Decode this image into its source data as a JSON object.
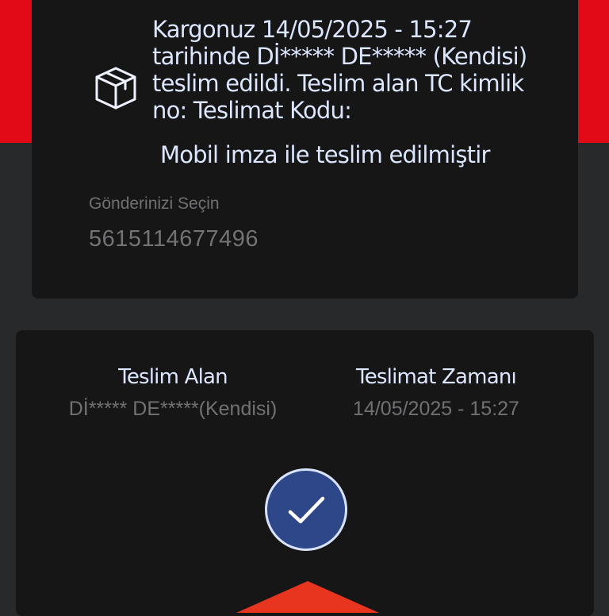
{
  "status": {
    "icon": "package-box-icon",
    "message": "Kargonuz 14/05/2025 - 15:27 tarihinde Dİ***** DE***** (Kendisi) teslim edildi. Teslim alan TC kimlik no: Teslimat Kodu:",
    "sub_message": "Mobil imza ile teslim edilmiştir"
  },
  "shipment_select": {
    "label": "Gönderinizi Seçin",
    "value": "5615114677496"
  },
  "details": {
    "receiver_header": "Teslim Alan",
    "receiver_value": "Dİ***** DE*****(Kendisi)",
    "time_header": "Teslimat Zamanı",
    "time_value": "14/05/2025 - 15:27",
    "status_icon": "checkmark-icon"
  },
  "colors": {
    "brand_red": "#e30a17",
    "card_bg": "#161617",
    "page_bg": "#28292b",
    "check_blue": "#2d4789",
    "text_light": "#dce6ff"
  }
}
